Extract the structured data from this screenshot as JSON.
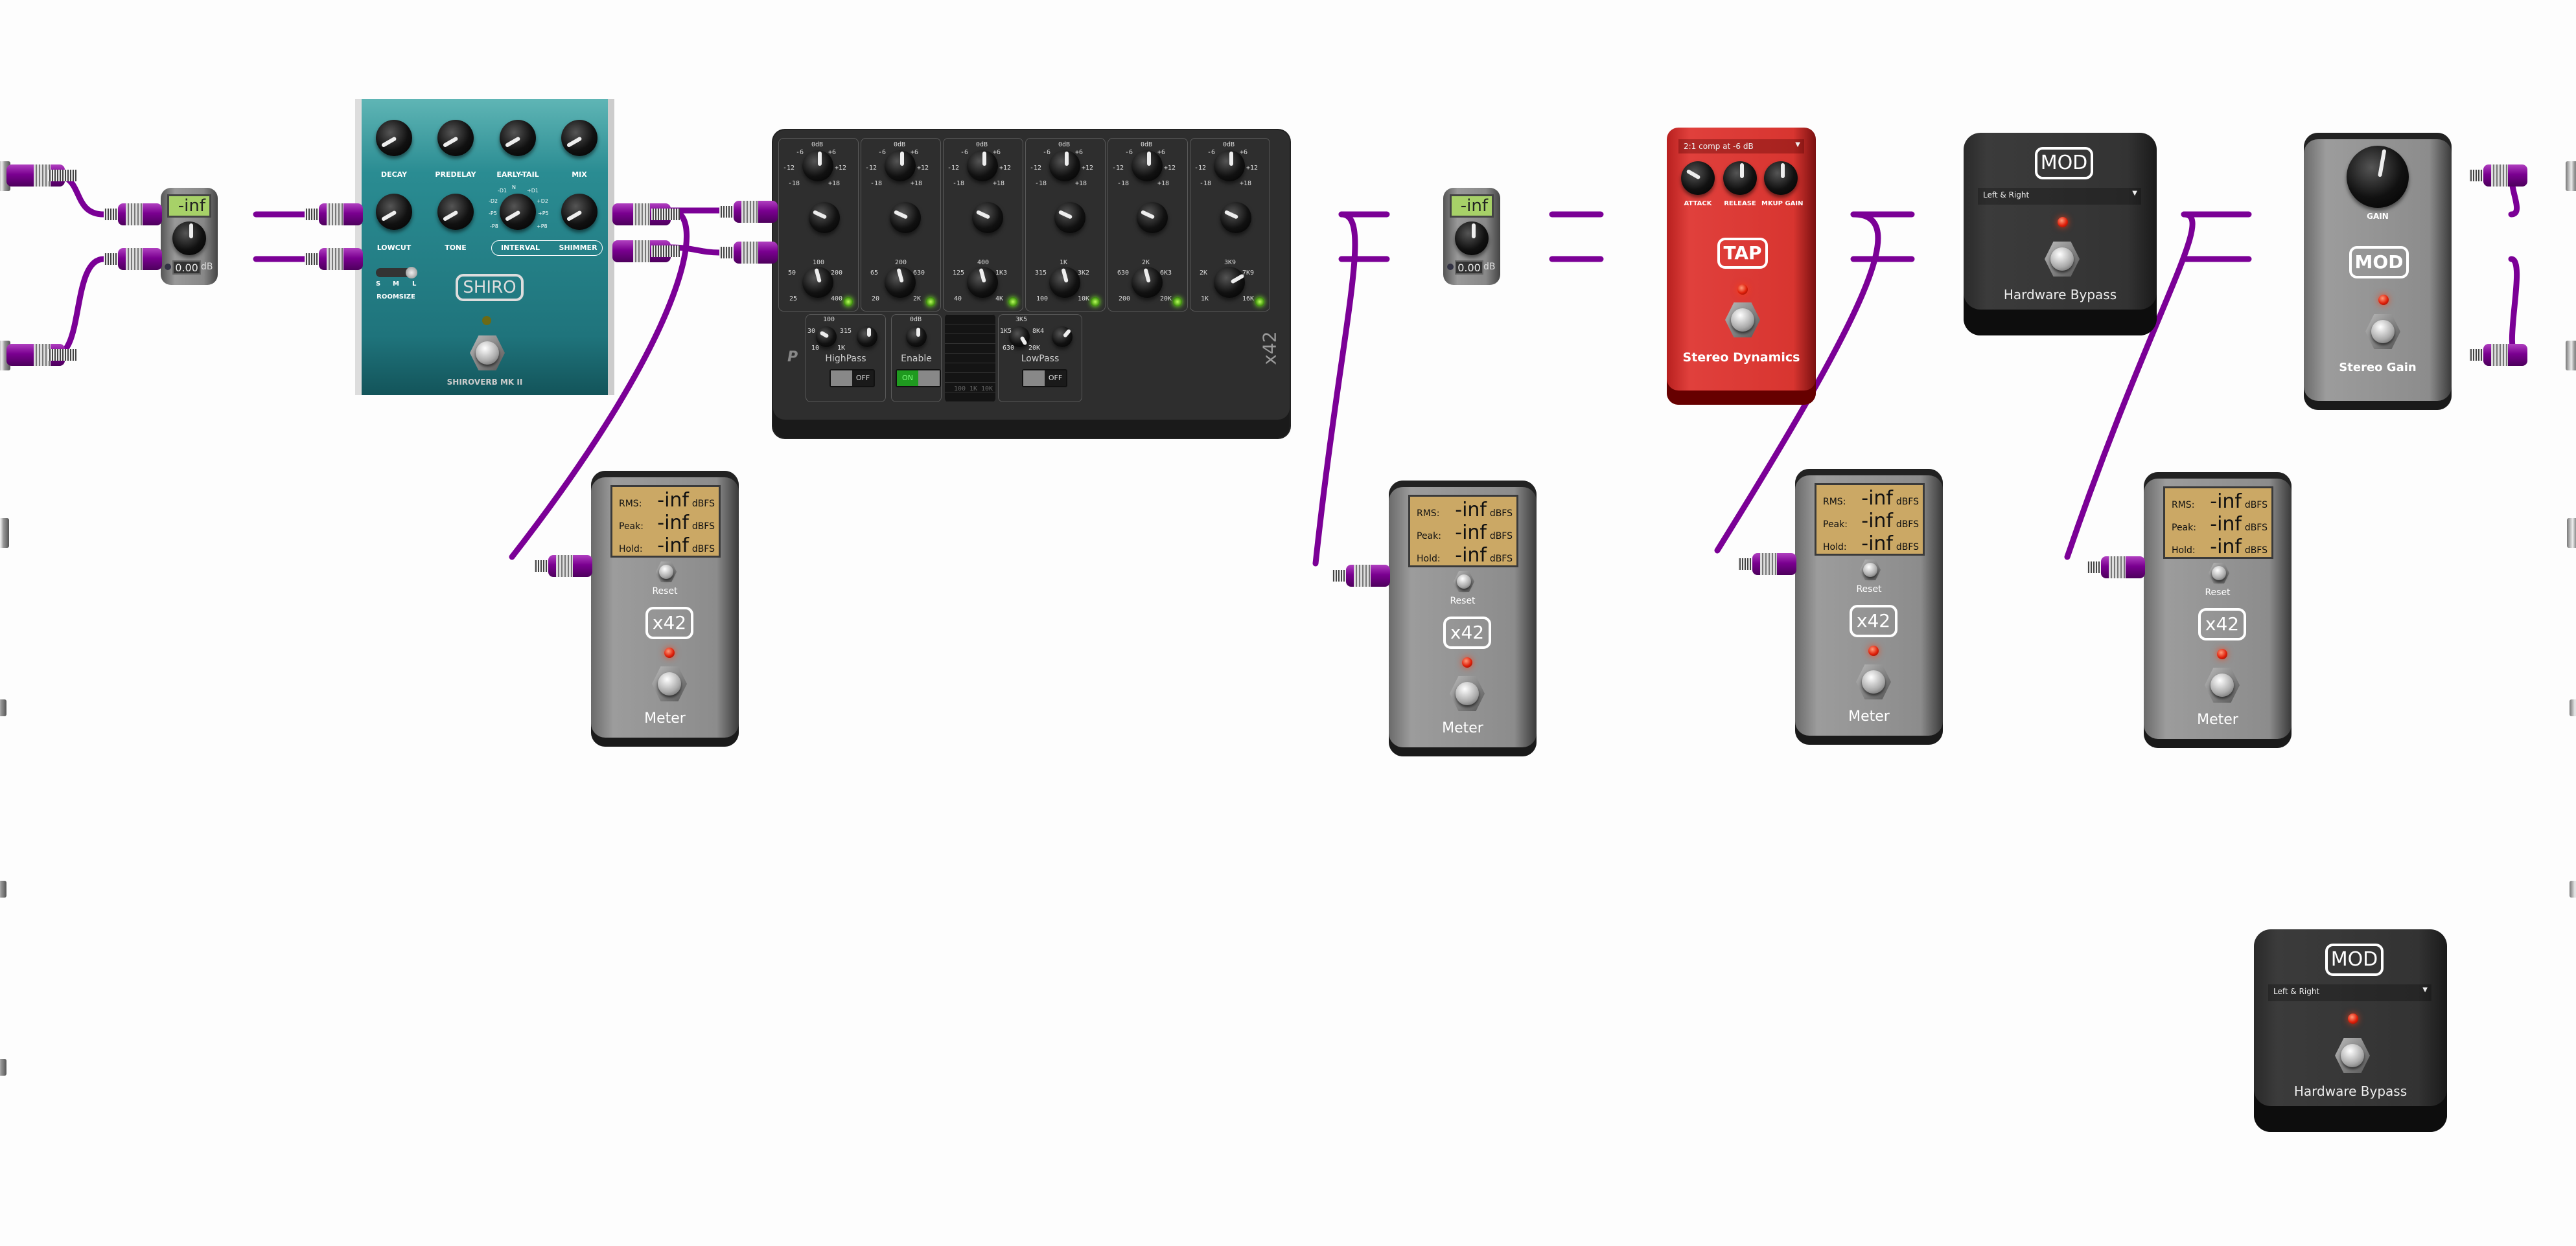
{
  "pedalboard": {
    "cable_color": "#7b0096",
    "system_io": {
      "left_inputs": [
        "capture-1",
        "capture-2"
      ],
      "right_outputs": [
        "playback-1",
        "playback-2"
      ]
    }
  },
  "gain_utils": [
    {
      "lcd": "-inf",
      "value": "0.00",
      "unit": "dB"
    },
    {
      "lcd": "-inf",
      "value": "0.00",
      "unit": "dB"
    }
  ],
  "shiroverb": {
    "brand": "SHIRO",
    "name": "SHIROVERB MK II",
    "knobs_row1": [
      "DECAY",
      "PREDELAY",
      "EARLY-TAIL",
      "MIX"
    ],
    "knobs_row2": [
      "LOWCUT",
      "TONE",
      "INTERVAL",
      "SHIMMER"
    ],
    "interval_marks": {
      "n": "N",
      "m1": "-D1",
      "p1": "+D1",
      "m2": "-D2",
      "p2": "+D2",
      "m5": "-P5",
      "p5": "+P5",
      "m8": "-P8",
      "p8": "+P8"
    },
    "roomsize_label": "ROOMSIZE",
    "roomsize_options": [
      "S",
      "M",
      "L"
    ],
    "roomsize_value": "L"
  },
  "eq": {
    "brand": "x42",
    "gain_ticks": {
      "top": "0dB",
      "m6": "-6",
      "p6": "+6",
      "m12": "-12",
      "p12": "+12",
      "m18": "-18",
      "p18": "+18"
    },
    "bands": [
      {
        "freq_ticks": {
          "top": "100",
          "l": "50",
          "r": "200",
          "bl": "25",
          "br": "400"
        }
      },
      {
        "freq_ticks": {
          "top": "200",
          "l": "65",
          "r": "630",
          "bl": "20",
          "br": "2K"
        }
      },
      {
        "freq_ticks": {
          "top": "400",
          "l": "125",
          "r": "1K3",
          "bl": "40",
          "br": "4K"
        }
      },
      {
        "freq_ticks": {
          "top": "1K",
          "l": "315",
          "r": "3K2",
          "bl": "100",
          "br": "10K"
        }
      },
      {
        "freq_ticks": {
          "top": "2K",
          "l": "630",
          "r": "6K3",
          "bl": "200",
          "br": "20K"
        }
      },
      {
        "freq_ticks": {
          "top": "3K9",
          "l": "2K",
          "r": "7K9",
          "bl": "1K",
          "br": "16K"
        }
      }
    ],
    "highpass": {
      "label": "HighPass",
      "state": "OFF",
      "ticks": {
        "top": "100",
        "l": "30",
        "r": "315",
        "bl": "10",
        "br": "1K"
      }
    },
    "enable": {
      "label": "Enable",
      "state": "ON"
    },
    "lowpass": {
      "label": "LowPass",
      "state": "OFF",
      "ticks": {
        "top": "3K5",
        "l": "1K5",
        "r": "8K4",
        "bl": "630",
        "br": "20K"
      }
    },
    "graph_ticks": [
      "100",
      "1K",
      "10K"
    ],
    "enable_color": "#1f9a1f"
  },
  "tap_dynamics": {
    "preset": "2:1 comp at -6 dB",
    "knobs": [
      "ATTACK",
      "RELEASE",
      "MKUP GAIN"
    ],
    "brand": "TAP",
    "name": "Stereo Dynamics"
  },
  "hw_bypass": [
    {
      "brand": "MOD",
      "mode": "Left & Right",
      "name": "Hardware Bypass"
    },
    {
      "brand": "MOD",
      "mode": "Left & Right",
      "name": "Hardware Bypass"
    }
  ],
  "stereo_gain": {
    "knob": "GAIN",
    "brand": "MOD",
    "name": "Stereo Gain"
  },
  "meters": [
    {
      "rows": [
        {
          "k": "RMS:",
          "v": "-inf",
          "u": "dBFS"
        },
        {
          "k": "Peak:",
          "v": "-inf",
          "u": "dBFS"
        },
        {
          "k": "Hold:",
          "v": "-inf",
          "u": "dBFS"
        }
      ],
      "reset": "Reset",
      "brand": "x42",
      "name": "Meter"
    },
    {
      "rows": [
        {
          "k": "RMS:",
          "v": "-inf",
          "u": "dBFS"
        },
        {
          "k": "Peak:",
          "v": "-inf",
          "u": "dBFS"
        },
        {
          "k": "Hold:",
          "v": "-inf",
          "u": "dBFS"
        }
      ],
      "reset": "Reset",
      "brand": "x42",
      "name": "Meter"
    },
    {
      "rows": [
        {
          "k": "RMS:",
          "v": "-inf",
          "u": "dBFS"
        },
        {
          "k": "Peak:",
          "v": "-inf",
          "u": "dBFS"
        },
        {
          "k": "Hold:",
          "v": "-inf",
          "u": "dBFS"
        }
      ],
      "reset": "Reset",
      "brand": "x42",
      "name": "Meter"
    },
    {
      "rows": [
        {
          "k": "RMS:",
          "v": "-inf",
          "u": "dBFS"
        },
        {
          "k": "Peak:",
          "v": "-inf",
          "u": "dBFS"
        },
        {
          "k": "Hold:",
          "v": "-inf",
          "u": "dBFS"
        }
      ],
      "reset": "Reset",
      "brand": "x42",
      "name": "Meter"
    }
  ]
}
